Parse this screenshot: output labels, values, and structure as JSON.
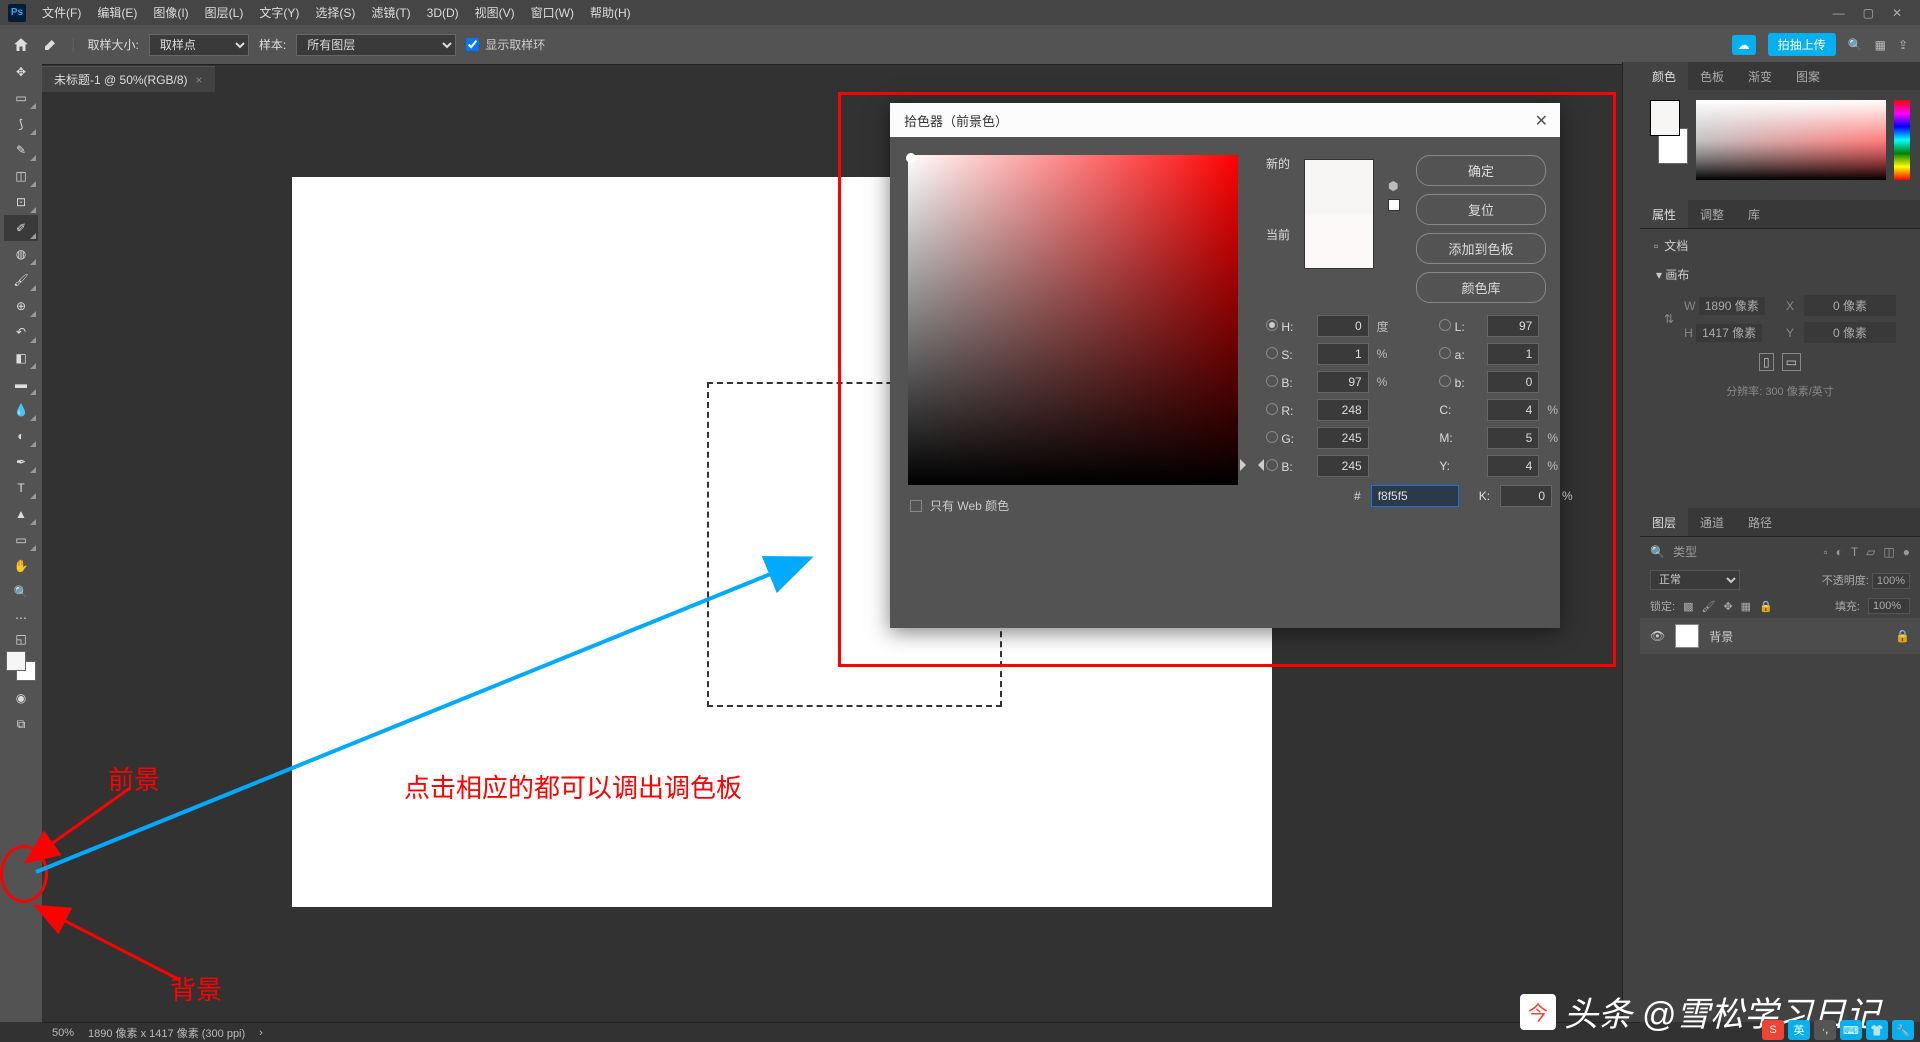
{
  "menu": [
    "文件(F)",
    "编辑(E)",
    "图像(I)",
    "图层(L)",
    "文字(Y)",
    "选择(S)",
    "滤镜(T)",
    "3D(D)",
    "视图(V)",
    "窗口(W)",
    "帮助(H)"
  ],
  "options": {
    "sample_size_label": "取样大小:",
    "sample_size_value": "取样点",
    "sample_label": "样本:",
    "sample_value": "所有图层",
    "show_ring": "显示取样环",
    "upload": "拍抽上传"
  },
  "doc_tab": "未标题-1 @ 50%(RGB/8)",
  "color_picker": {
    "title": "拾色器（前景色）",
    "new": "新的",
    "current": "当前",
    "ok": "确定",
    "reset": "复位",
    "add_swatch": "添加到色板",
    "color_lib": "颜色库",
    "web_only": "只有 Web 颜色",
    "H": "0",
    "H_unit": "度",
    "S": "1",
    "S_unit": "%",
    "Bv": "97",
    "Bv_unit": "%",
    "R": "248",
    "G": "245",
    "Bb": "245",
    "L": "97",
    "a": "1",
    "b": "0",
    "C": "4",
    "C_unit": "%",
    "M": "5",
    "M_unit": "%",
    "Y": "4",
    "Y_unit": "%",
    "K": "0",
    "K_unit": "%",
    "hex": "f8f5f5"
  },
  "right": {
    "tabs_color": [
      "颜色",
      "色板",
      "渐变",
      "图案"
    ],
    "tabs_props": [
      "属性",
      "调整",
      "库"
    ],
    "props_doc": "文档",
    "canvas": "画布",
    "W_label": "W",
    "W": "1890 像素",
    "X_label": "X",
    "X": "0 像素",
    "H_label": "H",
    "H": "1417 像素",
    "Y_label": "Y",
    "Y": "0 像素",
    "resolution": "分辨率: 300 像素/英寸",
    "tabs_layers": [
      "图层",
      "通道",
      "路径"
    ],
    "kind": "类型",
    "blend": "正常",
    "opacity_label": "不透明度:",
    "opacity": "100%",
    "lock_label": "锁定:",
    "fill_label": "填充:",
    "fill": "100%",
    "layer_name": "背景"
  },
  "annotations": {
    "fg": "前景",
    "bg": "背景",
    "tip": "点击相应的都可以调出调色板"
  },
  "watermark": "头条 @雪松学习日记",
  "status": {
    "zoom": "50%",
    "dims": "1890 像素 x 1417 像素 (300 ppi)"
  }
}
